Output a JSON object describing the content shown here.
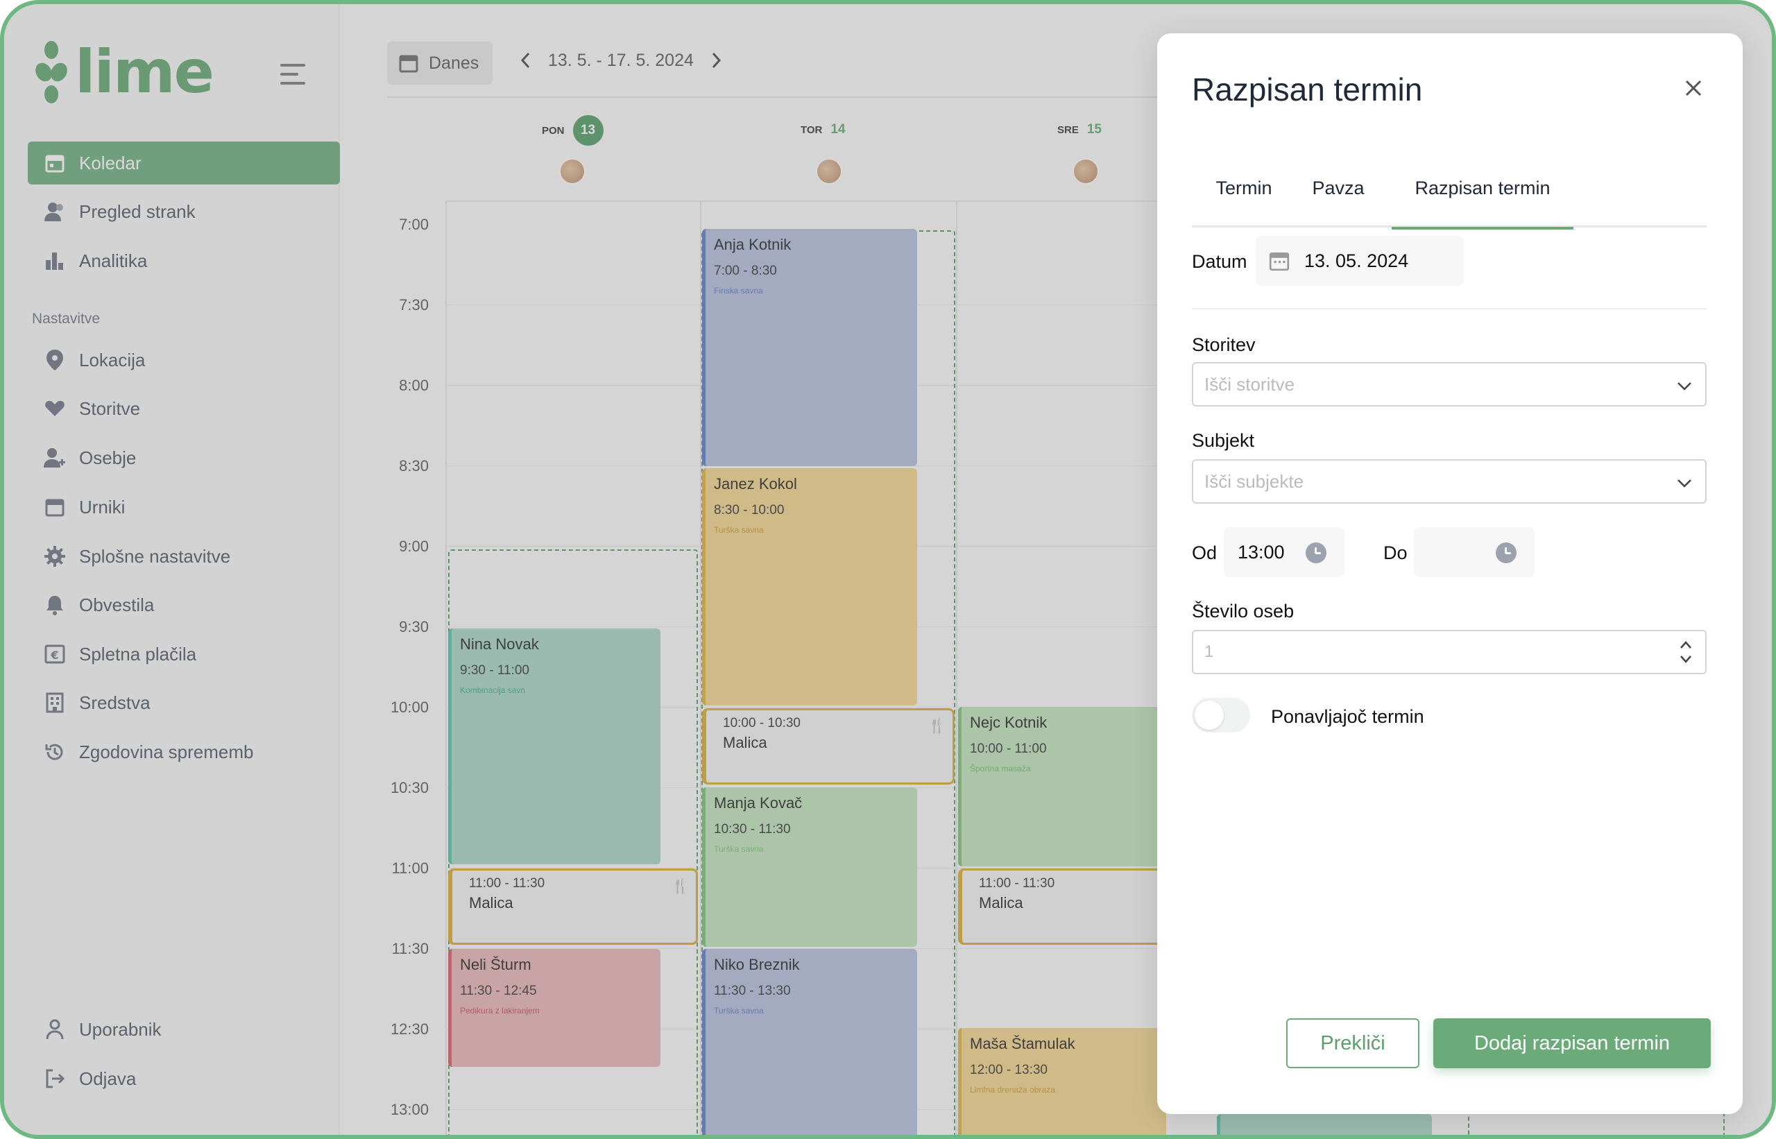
{
  "app": {
    "logo_text": "lime",
    "brand_color": "#6bab7a"
  },
  "sidebar": {
    "items": [
      {
        "label": "Koledar",
        "icon": "calendar-icon",
        "active": true
      },
      {
        "label": "Pregled strank",
        "icon": "users-icon"
      },
      {
        "label": "Analitika",
        "icon": "bar-chart-icon"
      }
    ],
    "section_title": "Nastavitve",
    "settings": [
      {
        "label": "Lokacija",
        "icon": "location-pin-icon"
      },
      {
        "label": "Storitve",
        "icon": "heart-hand-icon"
      },
      {
        "label": "Osebje",
        "icon": "user-plus-icon"
      },
      {
        "label": "Urniki",
        "icon": "calendar-icon"
      },
      {
        "label": "Splošne nastavitve",
        "icon": "gear-icon"
      },
      {
        "label": "Obvestila",
        "icon": "bell-icon"
      },
      {
        "label": "Spletna plačila",
        "icon": "euro-icon"
      },
      {
        "label": "Sredstva",
        "icon": "building-icon"
      },
      {
        "label": "Zgodovina sprememb",
        "icon": "history-icon"
      }
    ],
    "bottom": [
      {
        "label": "Uporabnik",
        "icon": "user-icon"
      },
      {
        "label": "Odjava",
        "icon": "logout-icon"
      }
    ]
  },
  "calendar": {
    "today_button": "Danes",
    "range": "13. 5. - 17. 5. 2024",
    "days": [
      {
        "abbr": "PON",
        "num": "13",
        "today": true
      },
      {
        "abbr": "TOR",
        "num": "14"
      },
      {
        "abbr": "SRE",
        "num": "15"
      }
    ],
    "times": [
      "7:00",
      "7:30",
      "8:00",
      "8:30",
      "9:00",
      "9:30",
      "10:00",
      "10:30",
      "11:00",
      "11:30",
      "12:30",
      "13:00"
    ],
    "events": [
      {
        "name": "Nina Novak",
        "time": "9:30 - 11:00",
        "service": "Kombinacija savn",
        "color": "teal"
      },
      {
        "name": "Neli Šturm",
        "time": "11:30 - 12:45",
        "service": "Pedikura z lakiranjem",
        "color": "red"
      },
      {
        "name": "Anja Kotnik",
        "time": "7:00 - 8:30",
        "service": "Finska savna",
        "color": "blue"
      },
      {
        "name": "Janez Kokol",
        "time": "8:30 - 10:00",
        "service": "Turška savna",
        "color": "yellow"
      },
      {
        "name": "Manja Kovač",
        "time": "10:30 - 11:30",
        "service": "Turška savna",
        "color": "green"
      },
      {
        "name": "Niko Breznik",
        "time": "11:30 - 13:30",
        "service": "Turška savna",
        "color": "blue"
      },
      {
        "name": "Nejc Kotnik",
        "time": "10:00 - 11:00",
        "service": "Športna masaža",
        "color": "green"
      },
      {
        "name": "Maša Štamulak",
        "time": "12:00 - 13:30",
        "service": "Limfna drenaža obraza",
        "color": "yellow"
      }
    ],
    "breaks": [
      {
        "time": "11:00 - 11:30",
        "name": "Malica"
      },
      {
        "time": "10:00 - 10:30",
        "name": "Malica"
      },
      {
        "time": "11:00 - 11:30",
        "name": "Malica"
      }
    ]
  },
  "modal": {
    "title": "Razpisan termin",
    "tabs": [
      "Termin",
      "Pavza",
      "Razpisan termin"
    ],
    "active_tab": "Razpisan termin",
    "date_label": "Datum",
    "date_value": "13. 05. 2024",
    "service_label": "Storitev",
    "service_placeholder": "Išči storitve",
    "subject_label": "Subjekt",
    "subject_placeholder": "Išči subjekte",
    "from_label": "Od",
    "from_value": "13:00",
    "to_label": "Do",
    "to_value": "",
    "people_label": "Število oseb",
    "people_placeholder": "1",
    "recurring_label": "Ponavljajoč termin",
    "recurring_on": false,
    "cancel_label": "Prekliči",
    "submit_label": "Dodaj razpisan termin"
  }
}
